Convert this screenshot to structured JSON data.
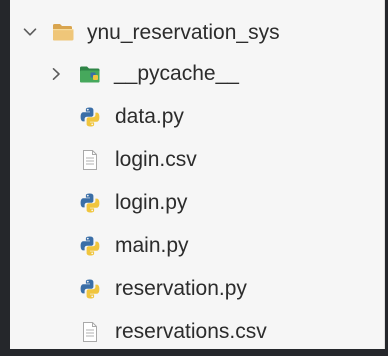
{
  "tree": {
    "root": {
      "label": "ynu_reservation_sys",
      "icon": "folder-open-icon",
      "expanded": true
    },
    "folders": [
      {
        "label": "__pycache__",
        "icon": "folder-icon",
        "expanded": false
      }
    ],
    "files": [
      {
        "label": "data.py",
        "icon": "python-icon"
      },
      {
        "label": "login.csv",
        "icon": "text-file-icon"
      },
      {
        "label": "login.py",
        "icon": "python-icon"
      },
      {
        "label": "main.py",
        "icon": "python-icon"
      },
      {
        "label": "reservation.py",
        "icon": "python-icon"
      },
      {
        "label": "reservations.csv",
        "icon": "text-file-icon"
      }
    ]
  },
  "colors": {
    "background": "#25272b",
    "panel": "#f6f6f6",
    "text": "#2c2c2c",
    "folder": "#e6ba6b",
    "pycache_folder": "#3f9d54",
    "python_blue": "#3a6ea7",
    "python_yellow": "#f0c53e"
  }
}
